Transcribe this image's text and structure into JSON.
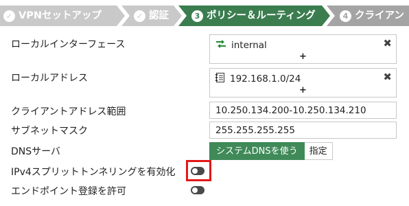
{
  "wizard": {
    "steps": [
      {
        "label": "VPNセットアップ",
        "marker": "✓",
        "state": "done"
      },
      {
        "label": "認証",
        "marker": "✓",
        "state": "done"
      },
      {
        "label": "ポリシー＆ルーティング",
        "marker": "3",
        "state": "active"
      },
      {
        "label": "クライアン",
        "marker": "4",
        "state": "todo"
      }
    ],
    "colors": {
      "done": "#c9c9c9",
      "active": "#3b7d4f",
      "todo": "#a4a4a4"
    }
  },
  "form": {
    "local_interface": {
      "label": "ローカルインターフェース",
      "value": "internal",
      "icon": "interface-icon",
      "remove": "✖",
      "add": "+"
    },
    "local_address": {
      "label": "ローカルアドレス",
      "value": "192.168.1.0/24",
      "icon": "address-object-icon",
      "remove": "✖",
      "add": "+"
    },
    "client_address_range": {
      "label": "クライアントアドレス範囲",
      "value": "10.250.134.200-10.250.134.210"
    },
    "subnet_mask": {
      "label": "サブネットマスク",
      "value": "255.255.255.255"
    },
    "dns_server": {
      "label": "DNSサーバ",
      "options": [
        "システムDNSを使う",
        "指定"
      ],
      "selected": "システムDNSを使う"
    },
    "ipv4_split_tunneling": {
      "label": "IPv4スプリットトンネリングを有効化",
      "enabled": false
    },
    "endpoint_registration": {
      "label": "エンドポイント登録を許可",
      "enabled": false
    }
  },
  "annotation": {
    "color": "#e21818",
    "target": "ipv4_split_tunneling"
  }
}
